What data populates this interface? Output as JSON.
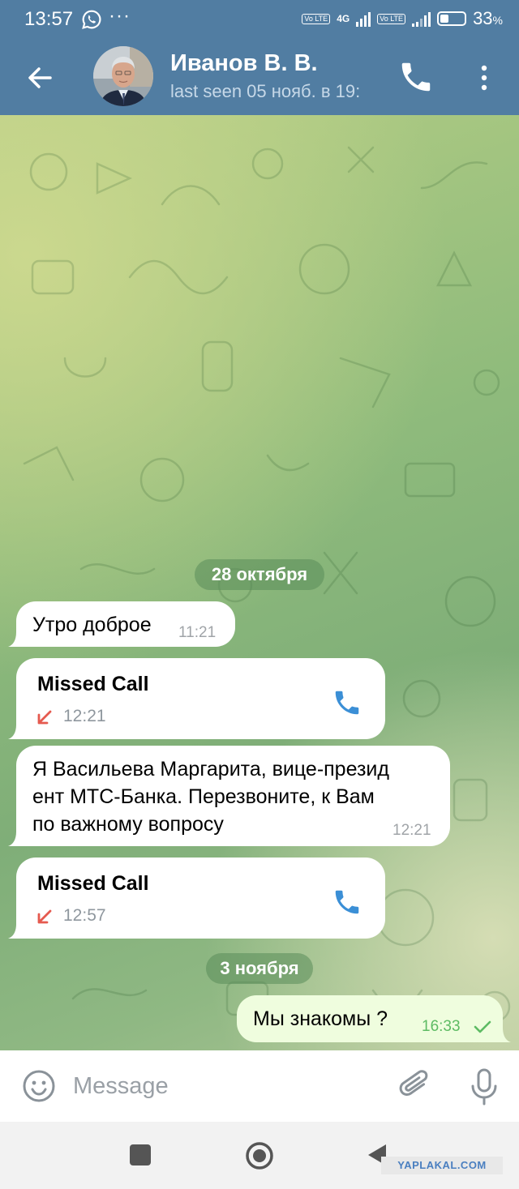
{
  "status_bar": {
    "time": "13:57",
    "more": "···",
    "net_badge_1": "Vo LTE",
    "net_type": "4G",
    "net_badge_2": "Vo LTE",
    "battery_percent": "33",
    "battery_unit": "%"
  },
  "header": {
    "contact_name": "Иванов В. В.",
    "last_seen": "last seen 05 нояб. в 19:"
  },
  "messages": {
    "date1": "28 октября",
    "msg1": {
      "text": "Утро доброе",
      "time": "11:21"
    },
    "call1": {
      "title": "Missed Call",
      "time": "12:21"
    },
    "msg2": {
      "line1": "Я Васильева Маргарита, вице-презид",
      "line2": "ент МТС-Банка. Перезвоните, к Вам",
      "line3": "по важному вопросу",
      "time": "12:21"
    },
    "call2": {
      "title": "Missed Call",
      "time": "12:57"
    },
    "date2": "3 ноября",
    "msg3": {
      "text": "Мы знакомы ?",
      "time": "16:33"
    }
  },
  "input": {
    "placeholder": "Message"
  },
  "watermark": "YAPLAKAL.COM",
  "colors": {
    "header_bg": "#517da2",
    "accent_blue": "#3b8fd6",
    "missed_red": "#e55a4f",
    "outgoing_bubble": "#effdde",
    "read_check_green": "#5dbb63"
  }
}
